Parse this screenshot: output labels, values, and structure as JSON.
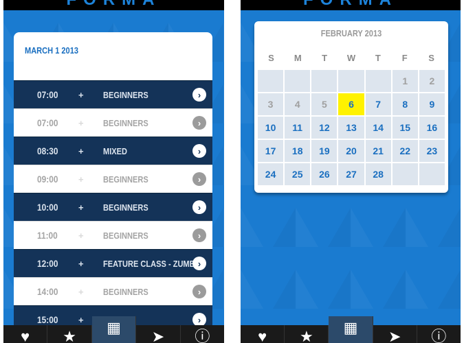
{
  "left_screen": {
    "brand": "FORMA",
    "date_header": "MARCH 1 2013",
    "rows": [
      {
        "time": "07:00",
        "plus": "+",
        "class_name": "BEGINNERS",
        "style": "dark"
      },
      {
        "time": "07:00",
        "plus": "+",
        "class_name": "BEGINNERS",
        "style": "light"
      },
      {
        "time": "08:30",
        "plus": "+",
        "class_name": "MIXED",
        "style": "dark"
      },
      {
        "time": "09:00",
        "plus": "+",
        "class_name": "BEGINNERS",
        "style": "light"
      },
      {
        "time": "10:00",
        "plus": "+",
        "class_name": "BEGINNERS",
        "style": "dark"
      },
      {
        "time": "11:00",
        "plus": "+",
        "class_name": "BEGINNERS",
        "style": "light"
      },
      {
        "time": "12:00",
        "plus": "+",
        "class_name": "FEATURE CLASS - ZUMBA",
        "style": "dark"
      },
      {
        "time": "14:00",
        "plus": "+",
        "class_name": "BEGINNERS",
        "style": "light"
      },
      {
        "time": "15:00",
        "plus": "+",
        "class_name": "",
        "style": "dark"
      }
    ],
    "tabs": [
      {
        "icon": "heart-icon",
        "glyph": "♥"
      },
      {
        "icon": "star-icon",
        "glyph": "★"
      },
      {
        "icon": "calendar-icon",
        "glyph": "▦",
        "active": true
      },
      {
        "icon": "send-icon",
        "glyph": "➤"
      },
      {
        "icon": "info-icon",
        "glyph": "ⓘ"
      }
    ]
  },
  "right_screen": {
    "brand": "FORMA",
    "month_label": "FEBRUARY 2013",
    "weekdays": [
      "S",
      "M",
      "T",
      "W",
      "T",
      "F",
      "S"
    ],
    "days": [
      {
        "label": "",
        "muted": false
      },
      {
        "label": "",
        "muted": false
      },
      {
        "label": "",
        "muted": false
      },
      {
        "label": "",
        "muted": false
      },
      {
        "label": "",
        "muted": false
      },
      {
        "label": "1",
        "muted": true
      },
      {
        "label": "2",
        "muted": true
      },
      {
        "label": "3",
        "muted": true
      },
      {
        "label": "4",
        "muted": true
      },
      {
        "label": "5",
        "muted": true
      },
      {
        "label": "6",
        "today": true
      },
      {
        "label": "7"
      },
      {
        "label": "8"
      },
      {
        "label": "9"
      },
      {
        "label": "10"
      },
      {
        "label": "11"
      },
      {
        "label": "12"
      },
      {
        "label": "13"
      },
      {
        "label": "14"
      },
      {
        "label": "15"
      },
      {
        "label": "16"
      },
      {
        "label": "17"
      },
      {
        "label": "18"
      },
      {
        "label": "19"
      },
      {
        "label": "20"
      },
      {
        "label": "21"
      },
      {
        "label": "22"
      },
      {
        "label": "23"
      },
      {
        "label": "24"
      },
      {
        "label": "25"
      },
      {
        "label": "26"
      },
      {
        "label": "27"
      },
      {
        "label": "28"
      },
      {
        "label": ""
      },
      {
        "label": ""
      }
    ],
    "tabs": [
      {
        "icon": "heart-icon",
        "glyph": "♥"
      },
      {
        "icon": "star-icon",
        "glyph": "★"
      },
      {
        "icon": "calendar-icon",
        "glyph": "▦",
        "active": true
      },
      {
        "icon": "send-icon",
        "glyph": "➤"
      },
      {
        "icon": "info-icon",
        "glyph": "ⓘ"
      }
    ]
  },
  "colors": {
    "background_blue": "#1a7bd0",
    "dark_row": "#143358",
    "accent_blue": "#1a6fc0",
    "today_highlight": "#fff200"
  }
}
